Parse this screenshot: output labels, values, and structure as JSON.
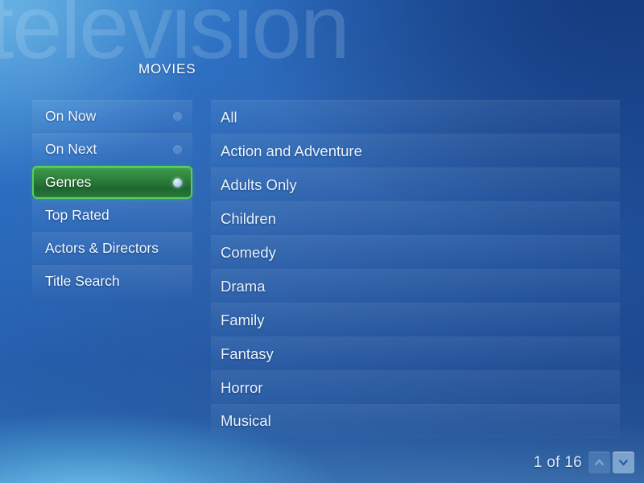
{
  "background": {
    "watermark_text": "television",
    "accent_green": "#2d7f3b",
    "accent_green_border": "#54d05f",
    "base_blue": "#2159a5"
  },
  "header": {
    "title": "MOVIES"
  },
  "sidebar": {
    "items": [
      {
        "label": "On Now",
        "selected": false,
        "has_dot": true
      },
      {
        "label": "On Next",
        "selected": false,
        "has_dot": true
      },
      {
        "label": "Genres",
        "selected": true,
        "has_dot": true
      },
      {
        "label": "Top Rated",
        "selected": false,
        "has_dot": false
      },
      {
        "label": "Actors & Directors",
        "selected": false,
        "has_dot": false
      },
      {
        "label": "Title Search",
        "selected": false,
        "has_dot": false
      }
    ]
  },
  "list": {
    "items": [
      {
        "label": "All"
      },
      {
        "label": "Action and Adventure"
      },
      {
        "label": "Adults Only"
      },
      {
        "label": "Children"
      },
      {
        "label": "Comedy"
      },
      {
        "label": "Drama"
      },
      {
        "label": "Family"
      },
      {
        "label": "Fantasy"
      },
      {
        "label": "Horror"
      },
      {
        "label": "Musical"
      }
    ]
  },
  "pager": {
    "text": "1 of 16",
    "current_page": 1,
    "total_pages": 16,
    "up_icon": "chevron-up-icon",
    "down_icon": "chevron-down-icon",
    "up_enabled": false,
    "down_enabled": true
  }
}
